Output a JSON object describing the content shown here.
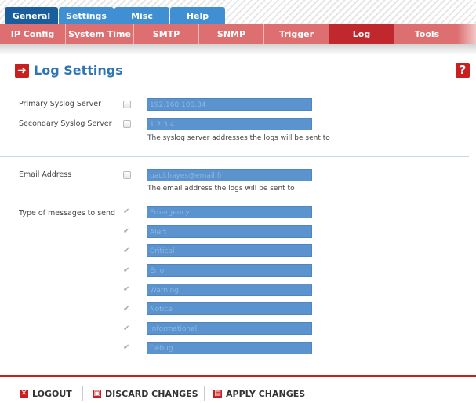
{
  "main_tabs": [
    "General",
    "Settings",
    "Misc",
    "Help"
  ],
  "sub_tabs": [
    "IP Config",
    "System Time",
    "SMTP",
    "SNMP",
    "Trigger",
    "Log",
    "Tools"
  ],
  "page": {
    "title": "Log Settings",
    "help_glyph": "?"
  },
  "syslog": {
    "primary_label": "Primary Syslog Server",
    "primary_value": "192.168.100.34",
    "secondary_label": "Secondary Syslog Server",
    "secondary_value": "1.2.3.4",
    "hint": "The syslog server addresses the logs will be sent to"
  },
  "email": {
    "label": "Email Address",
    "value": "paul.hayes@email.fr",
    "hint": "The email address the logs will be sent to"
  },
  "message_types": {
    "label": "Type of messages to send",
    "items": [
      "Emergency",
      "Alert",
      "Critical",
      "Error",
      "Warning",
      "Notice",
      "Informational",
      "Debug"
    ]
  },
  "footer": {
    "logout": "LOGOUT",
    "discard": "DISCARD CHANGES",
    "apply": "APPLY CHANGES"
  },
  "colors": {
    "brand_red": "#c82020",
    "tab_blue": "#1a5d9c",
    "field_blue": "#5b93cf",
    "subtab_red": "#dd6f70"
  },
  "icons": {
    "title": "arrow-right-icon",
    "help": "help-icon",
    "logout": "close-icon",
    "discard": "trash-icon",
    "apply": "save-icon"
  }
}
